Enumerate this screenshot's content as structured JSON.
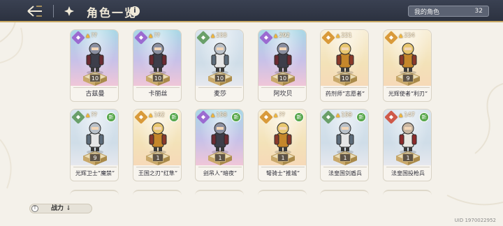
{
  "header": {
    "title": "角色一览",
    "my_characters_label": "我的角色",
    "my_characters_count": "32"
  },
  "cards_row1": [
    {
      "name": "古兹曼",
      "power": "??",
      "rank": "purple",
      "level": "10",
      "is_new": false
    },
    {
      "name": "卡丽丝",
      "power": "??",
      "rank": "purple",
      "level": "10",
      "is_new": false
    },
    {
      "name": "麦莎",
      "power": "233",
      "rank": "silver",
      "level": "10",
      "is_new": false
    },
    {
      "name": "阿坎贝",
      "power": "292",
      "rank": "purple",
      "level": "10",
      "is_new": false
    },
    {
      "name": "药剂师“志愿者”",
      "power": "221",
      "rank": "gold",
      "level": "10",
      "is_new": false
    },
    {
      "name": "光辉使者“利刃”",
      "power": "224",
      "rank": "gold",
      "level": "9",
      "is_new": false
    }
  ],
  "cards_row2": [
    {
      "name": "光辉卫士“魔禁”",
      "power": "??",
      "rank": "silver",
      "level": "9",
      "is_new": true
    },
    {
      "name": "王国之刃“红隼”",
      "power": "162",
      "rank": "gold",
      "level": "1",
      "is_new": true
    },
    {
      "name": "刽吊人“暗夜”",
      "power": "158",
      "rank": "purple",
      "level": "1",
      "is_new": true
    },
    {
      "name": "弩骑士“推城”",
      "power": "??",
      "rank": "gold",
      "level": "1",
      "is_new": true
    },
    {
      "name": "法皇国剑盾兵",
      "power": "159",
      "rank": "silver",
      "level": "1",
      "is_new": true
    },
    {
      "name": "法皇国投枪兵",
      "power": "147",
      "rank": "red",
      "level": "1",
      "is_new": true
    }
  ],
  "card_badges": {
    "new_label": "新"
  },
  "footer": {
    "sort_label": "战力",
    "sort_icon": "↓",
    "uid": "UID 1970022952"
  }
}
